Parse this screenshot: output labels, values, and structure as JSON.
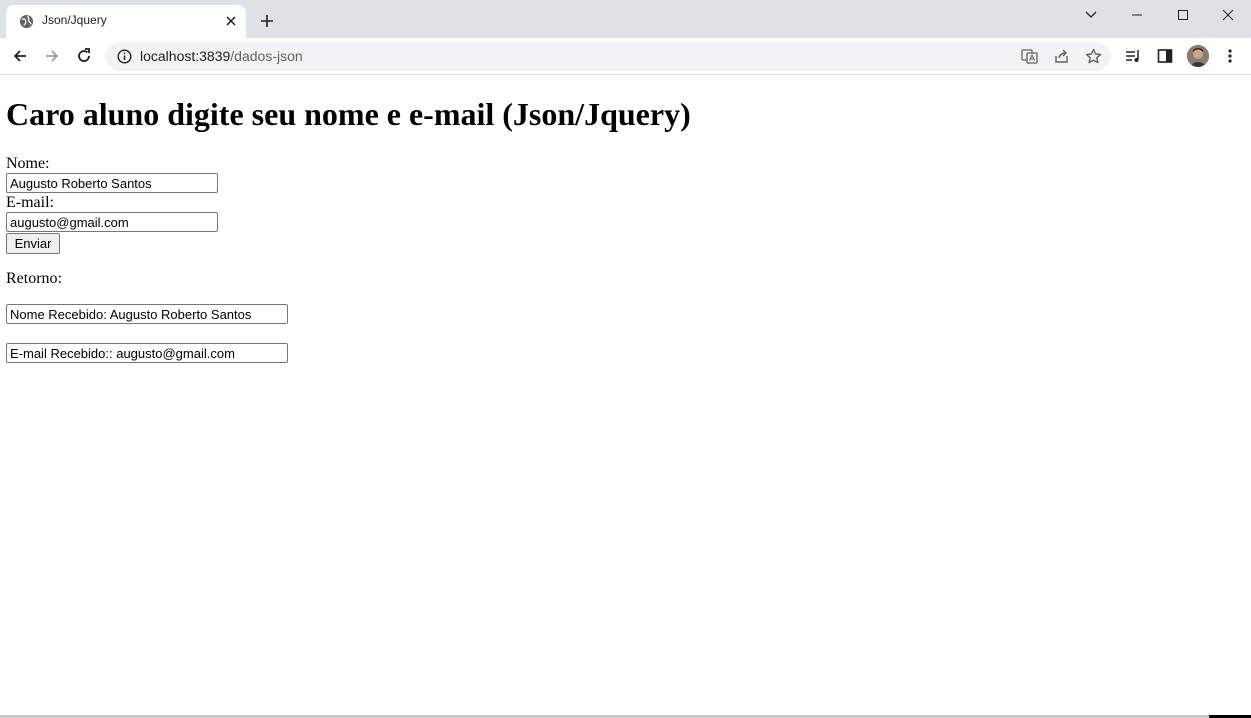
{
  "browser": {
    "tab_title": "Json/Jquery",
    "url_host": "localhost:3839",
    "url_path": "/dados-json"
  },
  "page": {
    "heading": "Caro aluno digite seu nome e e-mail (Json/Jquery)",
    "nome_label": "Nome:",
    "nome_value": "Augusto Roberto Santos",
    "email_label": "E-mail:",
    "email_value": "augusto@gmail.com",
    "submit_label": "Enviar",
    "retorno_label": "Retorno:",
    "nome_recebido": "Nome Recebido: Augusto Roberto Santos",
    "email_recebido": "E-mail Recebido:: augusto@gmail.com"
  }
}
